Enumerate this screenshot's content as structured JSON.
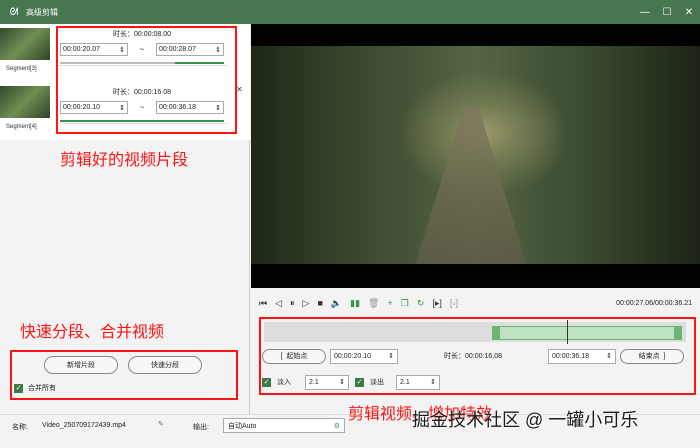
{
  "window": {
    "title": "高级剪辑"
  },
  "segments": [
    {
      "label": "Segment[3]",
      "duration": "时长：00:00:08.00",
      "start": "00:00:20.07",
      "end": "00:00:28.07"
    },
    {
      "label": "Segment[4]",
      "duration": "时长：00:00:16.08",
      "start": "00:00:20.10",
      "end": "00:00:36.18"
    }
  ],
  "annotations": {
    "clips": "剪辑好的视频片段",
    "split": "快速分段、合并视频",
    "edit": "剪辑视频、增加特效"
  },
  "buttons": {
    "add_segment": "新增片段",
    "quick_split": "快速分段",
    "merge_all": "合并所有"
  },
  "player": {
    "time": "00:00:27.06/00:00:36.21"
  },
  "trim": {
    "start_label": "起始点",
    "start": "00:00:20.10",
    "duration": "时长：00:00:16.08",
    "end": "00:00:36.18",
    "end_label": "结束点"
  },
  "fade": {
    "in_label": "淡入",
    "in_value": "2.1",
    "out_label": "淡出",
    "out_value": "2.1"
  },
  "bottom": {
    "name_label": "名称:",
    "name": "Video_250709172439.mp4",
    "output_label": "输出:",
    "output": "自动Auto"
  },
  "watermark": "掘金技术社区 @ 一罐小可乐"
}
